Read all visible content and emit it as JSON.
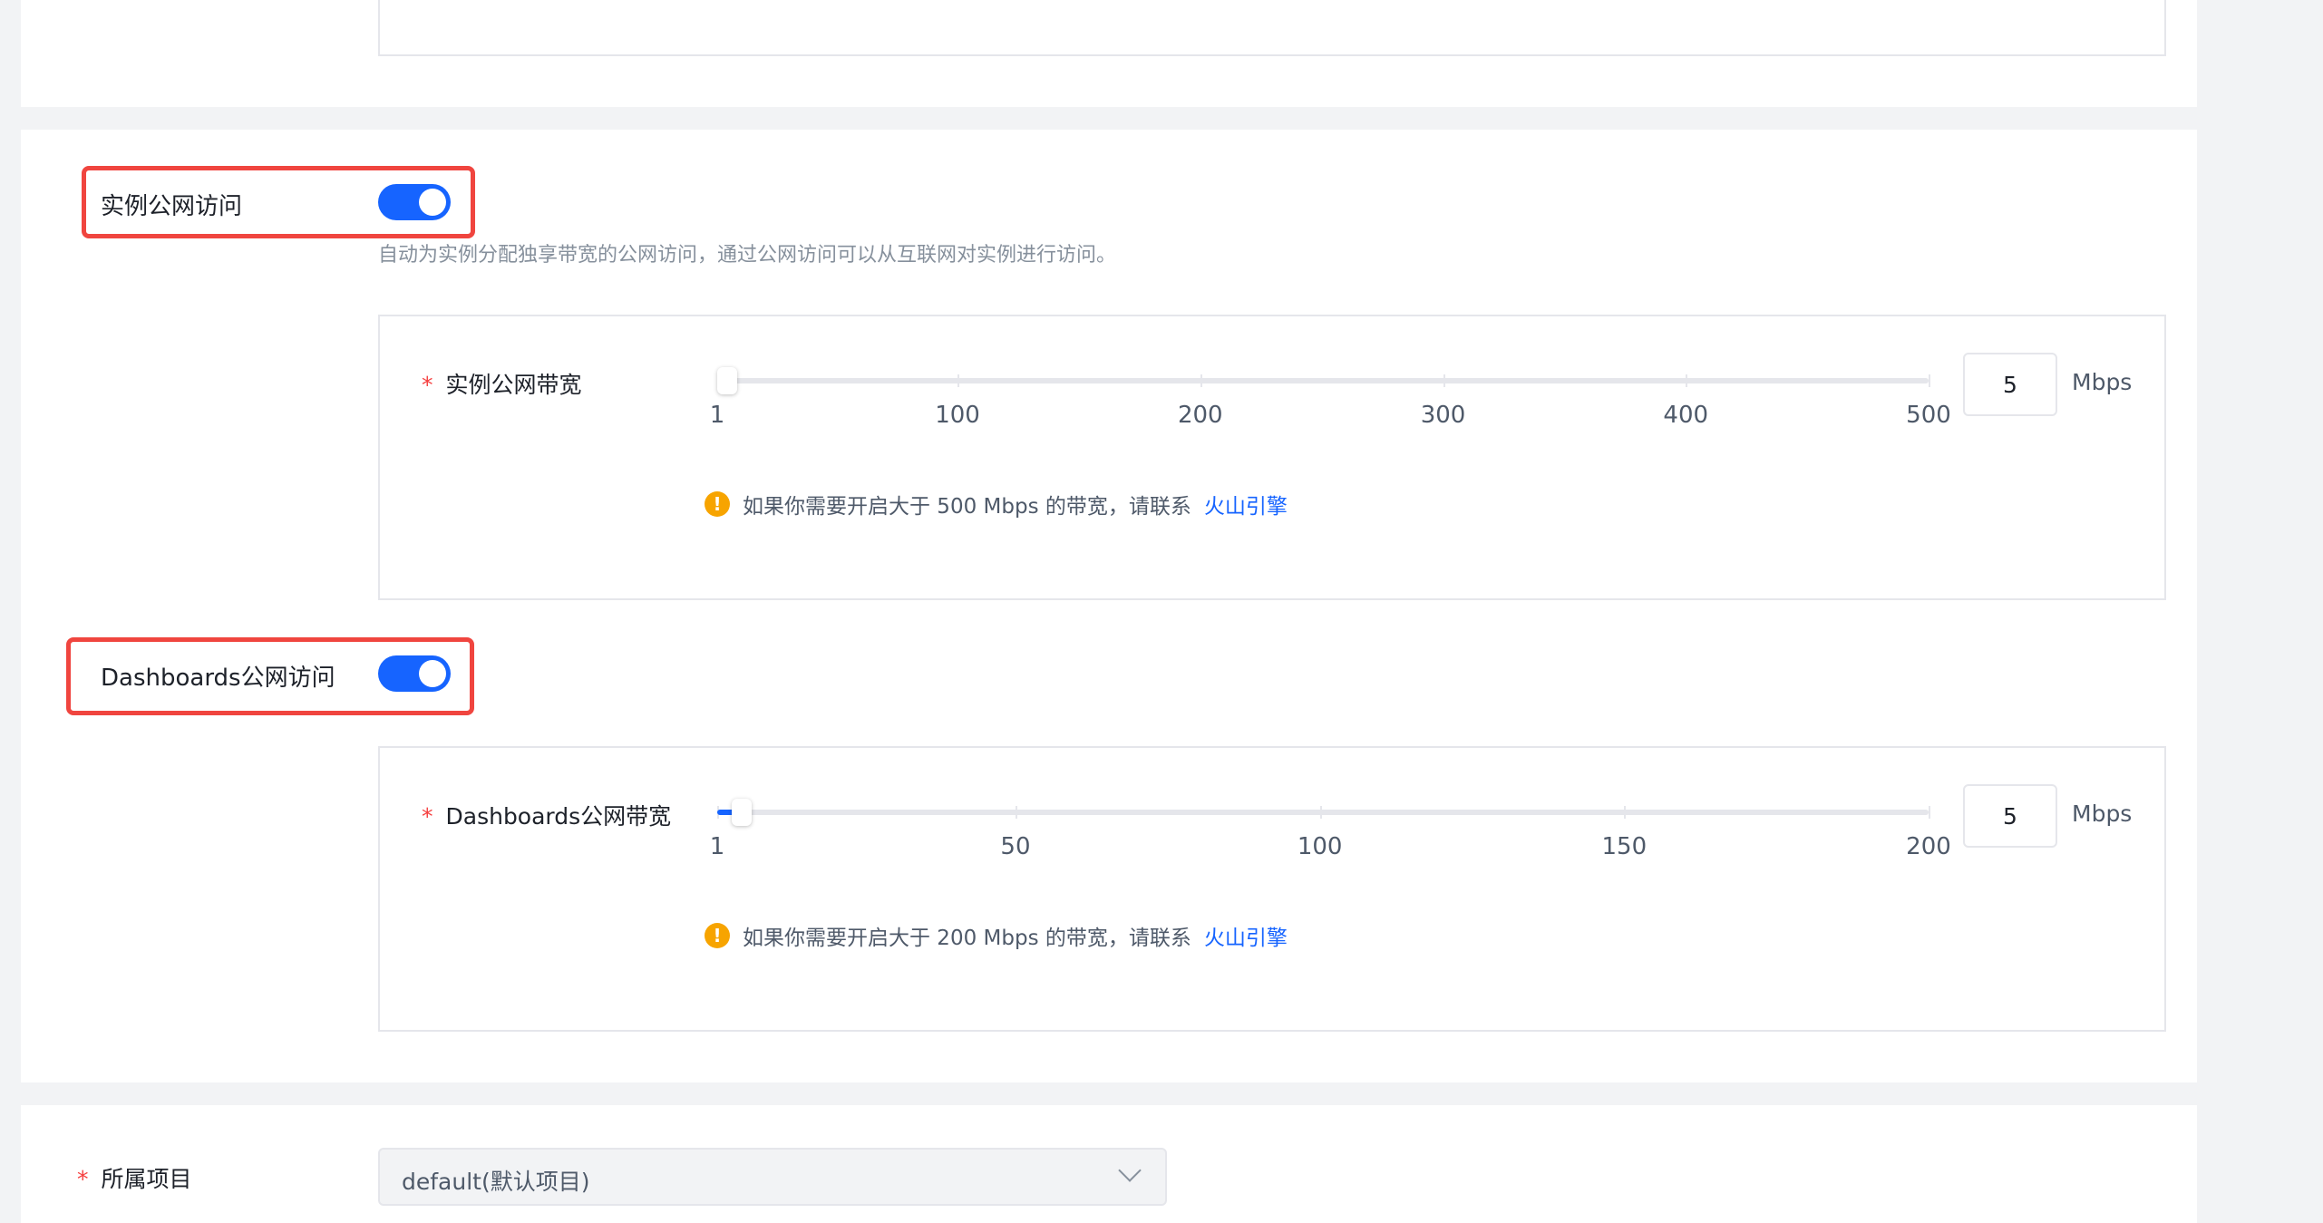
{
  "instance_public": {
    "label": "实例公网访问",
    "enabled": true,
    "description": "自动为实例分配独享带宽的公网访问，通过公网访问可以从互联网对实例进行访问。",
    "bandwidth": {
      "label": "实例公网带宽",
      "required_mark": "*",
      "min": 1,
      "max": 500,
      "value": 5,
      "tick_labels": [
        "1",
        "100",
        "200",
        "300",
        "400",
        "500"
      ],
      "tick_values": [
        1,
        100,
        200,
        300,
        400,
        500
      ],
      "input_value": "5",
      "unit": "Mbps",
      "hint_text": "如果你需要开启大于 500 Mbps 的带宽，请联系",
      "hint_link": "火山引擎"
    }
  },
  "dashboards_public": {
    "label": "Dashboards公网访问",
    "enabled": true,
    "bandwidth": {
      "label": "Dashboards公网带宽",
      "required_mark": "*",
      "min": 1,
      "max": 200,
      "value": 5,
      "tick_labels": [
        "1",
        "50",
        "100",
        "150",
        "200"
      ],
      "tick_values": [
        1,
        50,
        100,
        150,
        200
      ],
      "input_value": "5",
      "unit": "Mbps",
      "hint_text": "如果你需要开启大于 200 Mbps 的带宽，请联系",
      "hint_link": "火山引擎"
    }
  },
  "project": {
    "label": "所属项目",
    "required_mark": "*",
    "selected": "default(默认项目)"
  },
  "colors": {
    "accent": "#1664ff",
    "highlight": "#f0453f",
    "warning": "#f7a400",
    "required": "#f53f3f"
  }
}
